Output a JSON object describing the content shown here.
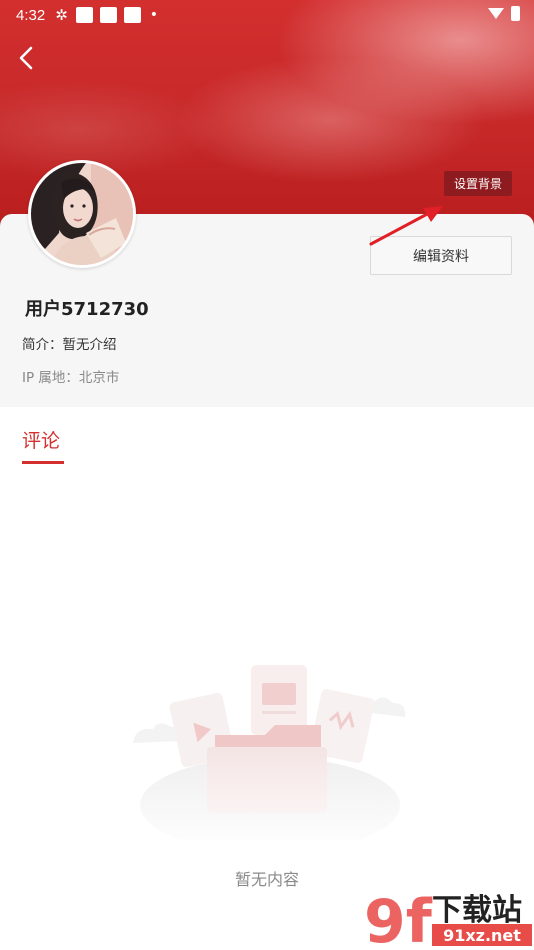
{
  "status_bar": {
    "time": "4:32",
    "dot": "•"
  },
  "header": {
    "set_background_label": "设置背景"
  },
  "profile": {
    "edit_label": "编辑资料",
    "username": "用户5712730",
    "bio": "简介：暂无介绍",
    "ip_location": "IP 属地：北京市"
  },
  "tabs": [
    {
      "label": "评论",
      "active": true
    }
  ],
  "empty_state": {
    "text": "暂无内容"
  },
  "watermark": {
    "logo_text": "9f",
    "brand_text": "下载站",
    "site_text": "91xz.net"
  },
  "colors": {
    "accent": "#d32f2f",
    "header_red": "#c62828",
    "set_bg_button": "#8e1b1f"
  }
}
